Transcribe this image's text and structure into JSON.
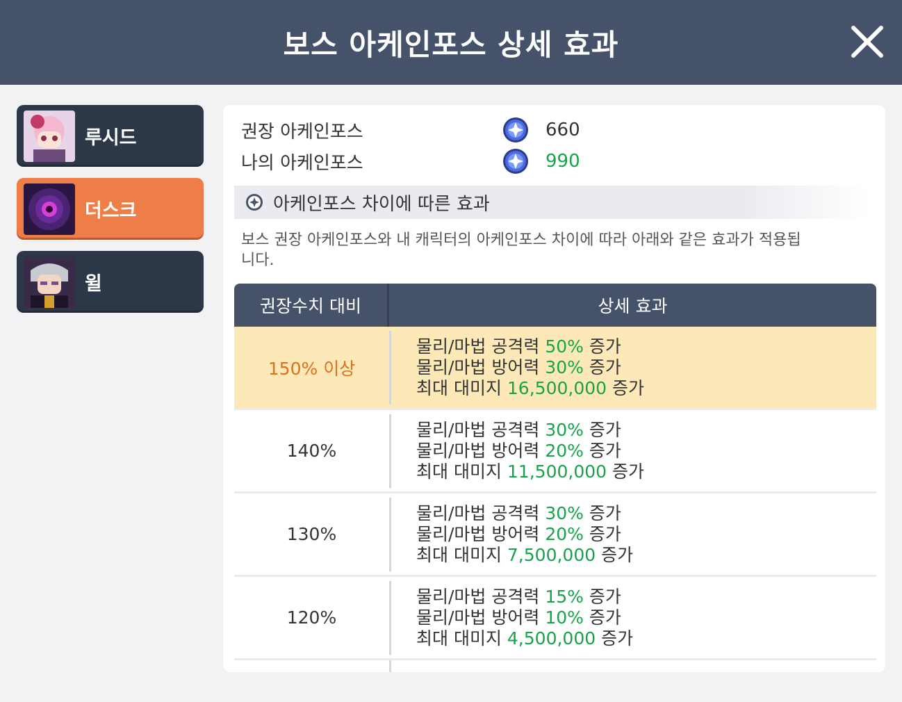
{
  "header": {
    "title": "보스 아케인포스 상세 효과"
  },
  "sidebar": {
    "items": [
      {
        "name": "루시드",
        "active": false
      },
      {
        "name": "더스크",
        "active": true
      },
      {
        "name": "윌",
        "active": false
      }
    ]
  },
  "panel": {
    "recommended_label": "권장 아케인포스",
    "recommended_value": "660",
    "mine_label": "나의 아케인포스",
    "mine_value": "990",
    "section_title": "아케인포스 차이에 따른 효과",
    "description": "보스 권장 아케인포스와 내 캐릭터의 아케인포스 차이에 따라 아래와 같은 효과가 적용됩니다.",
    "table": {
      "headers": [
        "권장수치 대비",
        "상세 효과"
      ],
      "rows": [
        {
          "ratio": "150% 이상",
          "attack_prefix": "물리/마법 공격력 ",
          "attack_value": "50%",
          "attack_suffix": " 증가",
          "defense_prefix": "물리/마법 방어력 ",
          "defense_value": "30%",
          "defense_suffix": " 증가",
          "damage_prefix": "최대 대미지 ",
          "damage_value": "16,500,000",
          "damage_suffix": " 증가"
        },
        {
          "ratio": "140%",
          "attack_prefix": "물리/마법 공격력 ",
          "attack_value": "30%",
          "attack_suffix": " 증가",
          "defense_prefix": "물리/마법 방어력 ",
          "defense_value": "20%",
          "defense_suffix": " 증가",
          "damage_prefix": "최대 대미지 ",
          "damage_value": "11,500,000",
          "damage_suffix": " 증가"
        },
        {
          "ratio": "130%",
          "attack_prefix": "물리/마법 공격력 ",
          "attack_value": "30%",
          "attack_suffix": " 증가",
          "defense_prefix": "물리/마법 방어력 ",
          "defense_value": "20%",
          "defense_suffix": " 증가",
          "damage_prefix": "최대 대미지 ",
          "damage_value": "7,500,000",
          "damage_suffix": " 증가"
        },
        {
          "ratio": "120%",
          "attack_prefix": "물리/마법 공격력 ",
          "attack_value": "15%",
          "attack_suffix": " 증가",
          "defense_prefix": "물리/마법 방어력 ",
          "defense_value": "10%",
          "defense_suffix": " 증가",
          "damage_prefix": "최대 대미지 ",
          "damage_value": "4,500,000",
          "damage_suffix": " 증가"
        }
      ]
    }
  },
  "colors": {
    "header_bg": "#46526a",
    "active_tab": "#ef7d47",
    "inactive_tab": "#2c3848",
    "highlight_row": "#fde9b8",
    "green_value": "#16a34a",
    "orange_value": "#e06f1e"
  },
  "icons": {
    "close": "close-icon",
    "arcane": "arcane-force-icon",
    "bullet": "circle-bullet-icon"
  }
}
